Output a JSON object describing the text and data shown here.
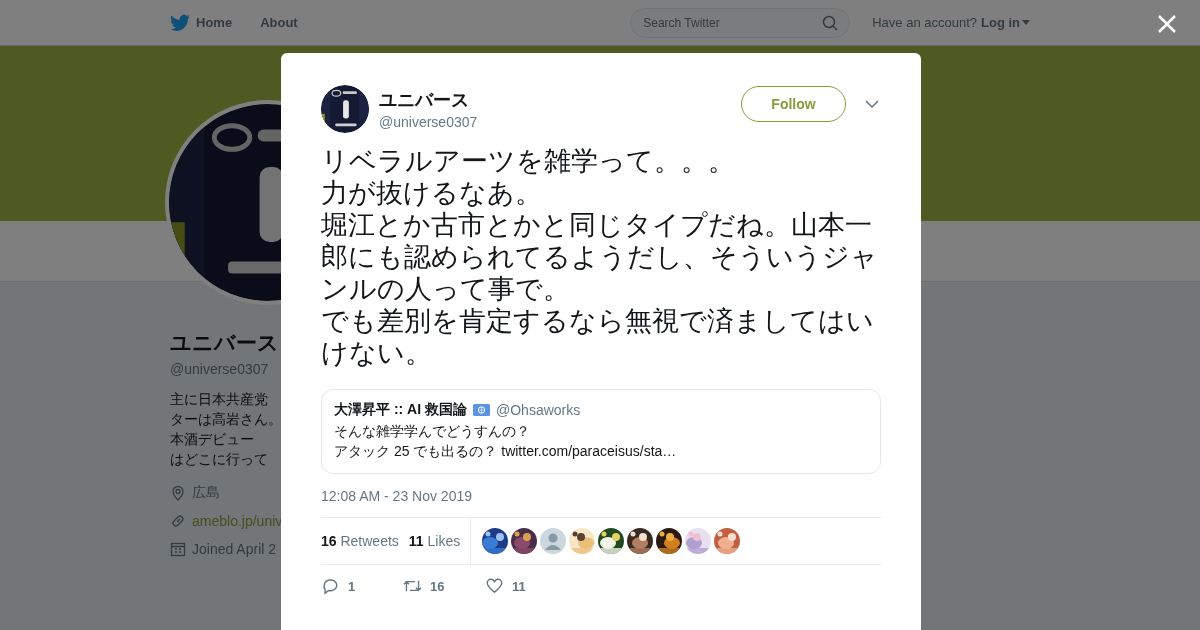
{
  "top_nav": {
    "links": [
      {
        "label": "Home",
        "kind": "home"
      },
      {
        "label": "About",
        "kind": "plain"
      }
    ],
    "search": {
      "placeholder": "Search Twitter"
    },
    "account_prompt": "Have an account?",
    "login": "Log in"
  },
  "profile": {
    "name": "ユニバース",
    "handle": "@universe0307",
    "bio_lines": [
      "主に日本共産党",
      "ターは高岩さん。",
      "本酒デビュー",
      "はどこに行って"
    ],
    "location": "広島",
    "url": "ameblo.jp/univ",
    "joined": "Joined April 2"
  },
  "tweet": {
    "author": {
      "name": "ユニバース",
      "handle": "@universe0307"
    },
    "follow_button": "Follow",
    "text_lines": [
      "リベラルアーツを雑学って。。。",
      "力が抜けるなあ。",
      "堀江とか古市とかと同じタイプだね。山本一郎にも認められてるようだし、そういうジャンルの人って事で。",
      "でも差別を肯定するなら無視で済ましてはいけない。"
    ],
    "quote": {
      "name": "大澤昇平 :: AI 救国論",
      "handle": "@Ohsaworks",
      "lines": [
        "そんな雑学学んでどうすんの？",
        "アタック 25 でも出るの？ twitter.com/paraceisus/sta…"
      ]
    },
    "timestamp": "12:08 AM - 23 Nov 2019",
    "stats": [
      {
        "count": "16",
        "label": "Retweets"
      },
      {
        "count": "11",
        "label": "Likes"
      }
    ],
    "likers": [
      {
        "kind": "picture"
      },
      {
        "kind": "picture"
      },
      {
        "kind": "silhouette"
      },
      {
        "kind": "picture"
      },
      {
        "kind": "picture"
      },
      {
        "kind": "picture"
      },
      {
        "kind": "picture"
      },
      {
        "kind": "picture"
      },
      {
        "kind": "picture"
      }
    ],
    "actions": [
      {
        "kind": "reply",
        "count": "1"
      },
      {
        "kind": "retweet",
        "count": "16"
      },
      {
        "kind": "like",
        "count": "11"
      }
    ]
  }
}
